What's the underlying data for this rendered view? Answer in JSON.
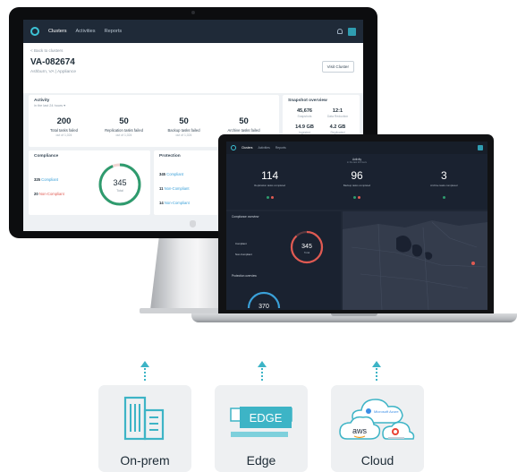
{
  "monitor": {
    "nav": {
      "items": [
        "Clusters",
        "Activities",
        "Reports"
      ],
      "active_index": 0
    },
    "back_link": "< Back to clusters",
    "cluster_name": "VA-082674",
    "cluster_sub": "Ashburn, VA | Appliance",
    "visit_button": "Visit Cluster",
    "activity": {
      "title": "Activity",
      "range": "in the last 24 hours ▾",
      "stats": [
        {
          "value": "200",
          "label": "Total tasks failed",
          "sub": "out of 1,024"
        },
        {
          "value": "50",
          "label": "Replication tasks failed",
          "sub": "out of 1,024"
        },
        {
          "value": "50",
          "label": "Backup tasks failed",
          "sub": "out of 1,024"
        },
        {
          "value": "50",
          "label": "Archive tasks failed",
          "sub": "out of 1,024"
        }
      ]
    },
    "snapshot": {
      "title": "Snapshot overview",
      "items": [
        {
          "value": "45,676",
          "label": "Snapshots"
        },
        {
          "value": "12:1",
          "label": "Data Reduction"
        },
        {
          "value": "14.9 GB",
          "label": "Ingested"
        },
        {
          "value": "4.2 GB",
          "label": "Replicated"
        }
      ]
    },
    "compliance": {
      "title": "Compliance",
      "compliant_count": "325",
      "compliant_label": "Compliant",
      "noncompliant_count": "20",
      "noncompliant_label": "Non-Compliant",
      "donut_value": "345",
      "donut_label": "Total",
      "compliant_fraction": 0.94
    },
    "protection": {
      "title": "Protection",
      "items": [
        {
          "count": "345",
          "label": "Compliant"
        },
        {
          "count": "11",
          "label": "Non-Compliant"
        },
        {
          "count": "14",
          "label": "Non-Compliant"
        }
      ]
    }
  },
  "laptop": {
    "nav": {
      "items": [
        "Clusters",
        "Activities",
        "Reports"
      ],
      "active_index": 0
    },
    "activity": {
      "title": "Activity",
      "range": "in the last 24 hours",
      "stats": [
        {
          "value": "114",
          "label": "Replication tasks completed"
        },
        {
          "value": "96",
          "label": "Backup tasks completed"
        },
        {
          "value": "3",
          "label": "Archive tasks completed"
        }
      ]
    },
    "compliance": {
      "title": "Compliance overview",
      "compliant_label": "Compliant",
      "noncompliant_label": "Non-Compliant",
      "donut_value": "345",
      "donut_label": "Total",
      "compliant_fraction": 0.88
    },
    "protection": {
      "title": "Protection overview",
      "donut_value": "370"
    }
  },
  "deploy_targets": [
    {
      "label": "On-prem",
      "icon": "buildings-icon"
    },
    {
      "label": "Edge",
      "icon": "edge-server-icon",
      "badge": "EDGE"
    },
    {
      "label": "Cloud",
      "icon": "cloud-providers-icon",
      "providers": [
        "Microsoft Azure",
        "aws"
      ]
    }
  ],
  "colors": {
    "accent": "#3db4c6",
    "compliant": "#2e9b6e",
    "noncompliant": "#e05a52",
    "nav_dark": "#1f2a38",
    "laptop_bg": "#1f2735"
  }
}
